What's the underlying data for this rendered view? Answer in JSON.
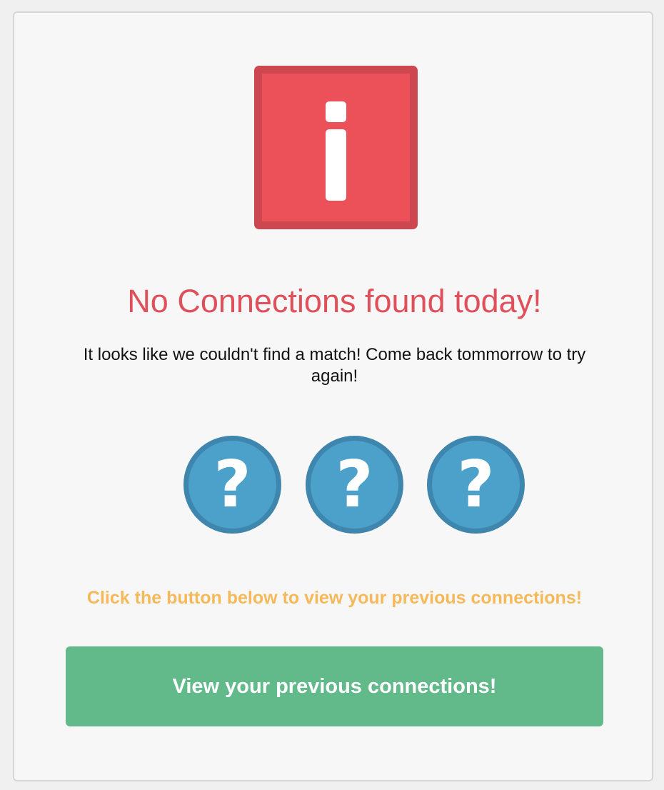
{
  "alert": {
    "icon": "info-icon",
    "title": "No Connections found today!",
    "message": "It looks like we couldn't find a match! Come back tommorrow to try again!"
  },
  "placeholders": [
    {
      "icon": "question-icon",
      "glyph": "?"
    },
    {
      "icon": "question-icon",
      "glyph": "?"
    },
    {
      "icon": "question-icon",
      "glyph": "?"
    }
  ],
  "hint": "Click the button below to view your previous connections!",
  "button": {
    "label": "View your previous connections!"
  },
  "colors": {
    "alert_red": "#ec5059",
    "alert_red_border": "#cc474f",
    "title_red": "#e0505b",
    "question_blue": "#4ba1c9",
    "question_blue_border": "#3e86ad",
    "hint_orange": "#f6b959",
    "button_green": "#62b98a"
  }
}
